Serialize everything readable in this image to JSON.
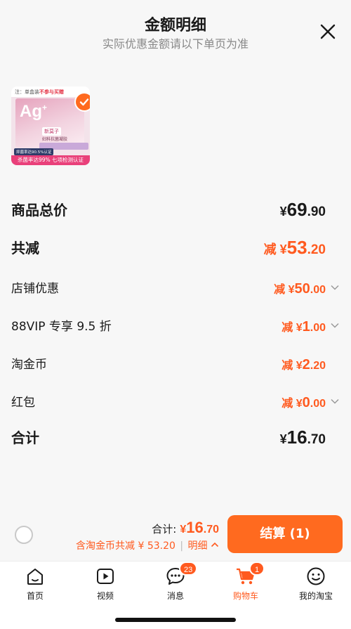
{
  "header": {
    "title": "金额明细",
    "subtitle": "实际优惠金额请以下单页为准"
  },
  "product": {
    "image_texts": {
      "top_note_prefix": "注：单盒装",
      "top_note_highlight": "不参与买赠",
      "ag_main": "Ag",
      "ag_sup": "+",
      "brand": "新莫子",
      "product_name": "妇科抗菌凝胶",
      "test_badge": "抑菌率达90.5%认证",
      "bottom_bar": "杀菌率达99% 七项检测认证"
    }
  },
  "rows": [
    {
      "label": "商品总价",
      "prefix": "¥",
      "int": "69",
      "dec": ".90",
      "style": "black",
      "size": "big",
      "arrow": false
    },
    {
      "label": "共减",
      "prefix": "减 ¥",
      "int": "53",
      "dec": ".20",
      "style": "orange",
      "size": "big",
      "arrow": false
    },
    {
      "label": "店铺优惠",
      "prefix": "减 ¥",
      "int": "50",
      "dec": ".00",
      "style": "orange",
      "size": "small",
      "arrow": true
    },
    {
      "label": "88VIP 专享 9.5 折",
      "prefix": "减 ¥",
      "int": "1",
      "dec": ".00",
      "style": "orange",
      "size": "small",
      "arrow": true
    },
    {
      "label": "淘金币",
      "prefix": "减 ¥",
      "int": "2",
      "dec": ".20",
      "style": "orange",
      "size": "small",
      "arrow": false
    },
    {
      "label": "红包",
      "prefix": "减 ¥",
      "int": "0",
      "dec": ".00",
      "style": "orange",
      "size": "small",
      "arrow": true
    },
    {
      "label": "合计",
      "prefix": "¥",
      "int": "16",
      "dec": ".70",
      "style": "black",
      "size": "big",
      "arrow": false
    }
  ],
  "actionbar": {
    "total_label": "合计:",
    "total_prefix": "¥",
    "total_int": "16",
    "total_dec": ".70",
    "savings_text": "含淘金币共减 ¥ 53.20",
    "separator": "|",
    "detail_label": "明细",
    "detail_icon": "^",
    "checkout_label": "结算 (1)"
  },
  "tabbar": [
    {
      "label": "首页",
      "icon": "home-icon",
      "active": false,
      "badge": ""
    },
    {
      "label": "视频",
      "icon": "video-icon",
      "active": false,
      "badge": ""
    },
    {
      "label": "消息",
      "icon": "message-icon",
      "active": false,
      "badge": "23"
    },
    {
      "label": "购物车",
      "icon": "cart-icon",
      "active": true,
      "badge": "1"
    },
    {
      "label": "我的淘宝",
      "icon": "profile-icon",
      "active": false,
      "badge": ""
    }
  ],
  "colors": {
    "accent": "#ff5a1f",
    "button": "#ff6a1f",
    "text": "#1a1a1a",
    "muted": "#888888"
  }
}
